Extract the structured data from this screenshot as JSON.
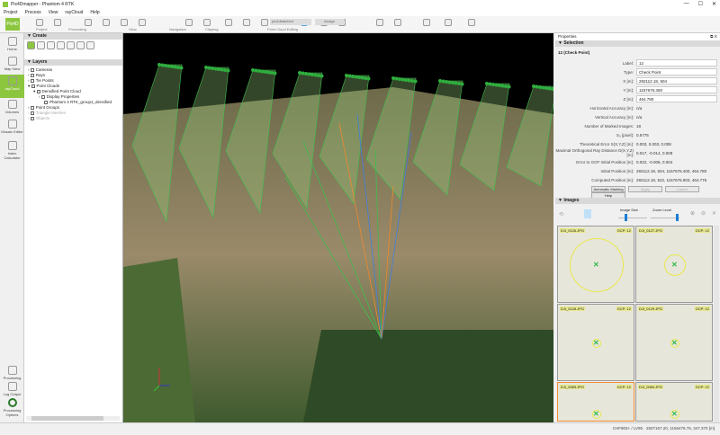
{
  "window": {
    "title": "Pix4Dmapper - Phantom 4 RTK",
    "controls": [
      "—",
      "☐",
      "✕"
    ]
  },
  "menu": [
    "Project",
    "Process",
    "View",
    "rayCloud",
    "Help"
  ],
  "toolbar": {
    "logo": "Pix4D",
    "groups": [
      "Project",
      "Processing",
      "View",
      "Navigation",
      "Clipping",
      "Point Cloud Editing"
    ],
    "point_cloud_select": "pix4dbatched",
    "assign_label": "Assign"
  },
  "iconbar": {
    "top": [
      {
        "label": "Home"
      },
      {
        "label": "Map View"
      },
      {
        "label": "rayCloud",
        "active": true
      },
      {
        "label": "Volumes"
      },
      {
        "label": "Mosaic Editor"
      },
      {
        "label": "Index Calculator"
      }
    ],
    "bottom": [
      {
        "label": "Processing"
      },
      {
        "label": "Log Output"
      },
      {
        "label": "Processing Options"
      }
    ]
  },
  "left": {
    "create_title": "Create",
    "layers_title": "Layers",
    "tree": [
      {
        "label": "Cameras",
        "level": 0,
        "checked": true
      },
      {
        "label": "Rays",
        "level": 0,
        "checked": true
      },
      {
        "label": "Tie Points",
        "level": 0,
        "checked": true
      },
      {
        "label": "Point Clouds",
        "level": 0,
        "checked": true
      },
      {
        "label": "Densified Point Cloud",
        "level": 1,
        "checked": true
      },
      {
        "label": "Display Properties",
        "level": 2
      },
      {
        "label": "Phantom 4 RTK_group1_densified",
        "level": 3,
        "checked": true
      },
      {
        "label": "Point Groups",
        "level": 0,
        "checked": true
      },
      {
        "label": "Triangle Meshes",
        "level": 0,
        "disabled": true
      },
      {
        "label": "Objects",
        "level": 0,
        "disabled": true
      }
    ]
  },
  "properties": {
    "title": "Properties",
    "section": "Selection",
    "heading": "12 (Check Point)",
    "fields": [
      {
        "label": "Label:",
        "value": "12"
      },
      {
        "label": "Type:",
        "value": "Check Point"
      },
      {
        "label": "X [m]:",
        "value": "292112.18, 504"
      },
      {
        "label": "Y [m]:",
        "value": "1157676.350"
      },
      {
        "label": "Z [m]:",
        "value": "464.780"
      }
    ],
    "info": [
      {
        "label": "Horizontal Accuracy [m]:",
        "value": "n/a"
      },
      {
        "label": "Vertical Accuracy [m]:",
        "value": "n/a"
      },
      {
        "label": "Number of Marked Images:",
        "value": "18"
      },
      {
        "label": "S₀ [pixel]:",
        "value": "0.5775"
      },
      {
        "label": "Theoretical Error S(X,Y,Z) [m]:",
        "value": "0.003, 0.003, 0.008"
      },
      {
        "label": "Maximal Orthogonal Ray Distance D(X,Y,Z) [m]:",
        "value": "0.017, -0.014, 0.009"
      },
      {
        "label": "Error to GCP Initial Position [m]:",
        "value": "0.022, -0.008, 0.004"
      },
      {
        "label": "Initial Position [m]:",
        "value": "292112.18, 504, 1157676.400, 464.780"
      },
      {
        "label": "Computed Position [m]:",
        "value": "292112.18, 522, 1157676.903, 464.776"
      }
    ],
    "buttons": [
      "Automatic Marking",
      "Apply",
      "Cancel",
      "Help"
    ]
  },
  "images": {
    "title": "Images",
    "image_size_label": "Image Size",
    "zoom_level_label": "Zoom Level",
    "thumbs": [
      {
        "name": "DJI_0126.JPG",
        "gcp": "GCP: 12"
      },
      {
        "name": "DJI_0127.JPG",
        "gcp": "GCP: 12"
      },
      {
        "name": "DJI_0128.JPG",
        "gcp": "GCP: 12"
      },
      {
        "name": "DJI_0129.JPG",
        "gcp": "GCP: 12"
      },
      {
        "name": "DJI_0083.JPG",
        "gcp": "GCP: 12"
      },
      {
        "name": "DJI_0084.JPG",
        "gcp": "GCP: 12"
      }
    ]
  },
  "status": "CHF903+ / LV95 · 2507167.20, 1156476.76, 347.370 [m]"
}
